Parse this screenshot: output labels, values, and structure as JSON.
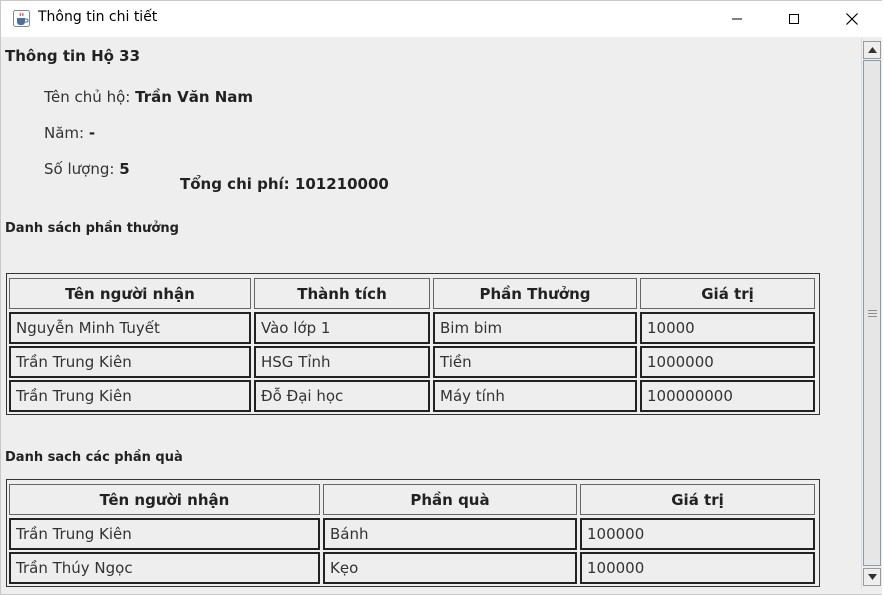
{
  "window": {
    "title": "Thông tin chi tiết",
    "icon": "java-cup-icon"
  },
  "household": {
    "title": "Thông tin Hộ 33",
    "owner_label": "Tên chủ hộ:",
    "owner_value": "Trần Văn Nam",
    "year_label": "Năm:",
    "year_value": "-",
    "count_label": "Số lượng:",
    "count_value": "5",
    "total_label": "Tổng chi phí:",
    "total_value": "101210000"
  },
  "rewards": {
    "section_title": "Danh sách phần thưởng",
    "headers": [
      "Tên người nhận",
      "Thành tích",
      "Phần Thưởng",
      "Giá trị"
    ],
    "rows": [
      [
        "Nguyễn Minh Tuyết",
        "Vào lớp 1",
        "Bim bim",
        "10000"
      ],
      [
        "Trần Trung Kiên",
        "HSG Tỉnh",
        "Tiền",
        "1000000"
      ],
      [
        "Trần Trung Kiên",
        "Đỗ Đại học",
        "Máy tính",
        "100000000"
      ]
    ]
  },
  "gifts": {
    "section_title": "Danh sach các phần quà",
    "headers": [
      "Tên người nhận",
      "Phần quà",
      "Giá trị"
    ],
    "rows": [
      [
        "Trần Trung Kiên",
        "Bánh",
        "100000"
      ],
      [
        "Trần Thúy Ngọc",
        "Kẹo",
        "100000"
      ]
    ]
  },
  "colors": {
    "background": "#eeeeee",
    "titlebar": "#ffffff",
    "border": "#333333"
  }
}
